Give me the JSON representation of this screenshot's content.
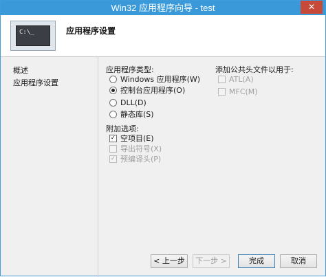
{
  "window": {
    "title": "Win32 应用程序向导 - test",
    "close_glyph": "✕"
  },
  "header": {
    "graphic_text": "C:\\_",
    "title": "应用程序设置"
  },
  "nav": {
    "items": [
      {
        "label": "概述"
      },
      {
        "label": "应用程序设置"
      }
    ]
  },
  "app_type": {
    "label": "应用程序类型:",
    "options": [
      {
        "label": "Windows 应用程序(W)",
        "checked": false
      },
      {
        "label": "控制台应用程序(O)",
        "checked": true
      },
      {
        "label": "DLL(D)",
        "checked": false
      },
      {
        "label": "静态库(S)",
        "checked": false
      }
    ]
  },
  "additional": {
    "label": "附加选项:",
    "options": [
      {
        "label": "空项目(E)",
        "checked": true,
        "enabled": true
      },
      {
        "label": "导出符号(X)",
        "checked": false,
        "enabled": false
      },
      {
        "label": "预编译头(P)",
        "checked": true,
        "enabled": false
      }
    ]
  },
  "common_headers": {
    "label": "添加公共头文件以用于:",
    "options": [
      {
        "label": "ATL(A)",
        "checked": false,
        "enabled": false
      },
      {
        "label": "MFC(M)",
        "checked": false,
        "enabled": false
      }
    ]
  },
  "buttons": {
    "prev": "< 上一步",
    "next": "下一步 >",
    "finish": "完成",
    "cancel": "取消"
  },
  "check_glyph": "✓"
}
